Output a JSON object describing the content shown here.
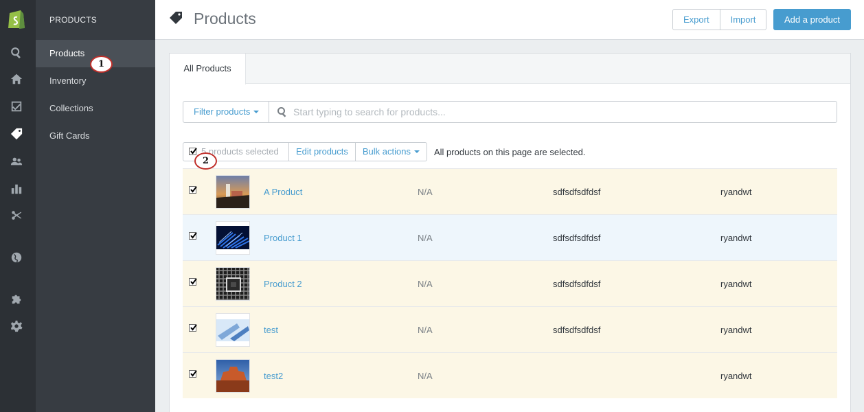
{
  "subnav": {
    "heading": "PRODUCTS",
    "items": [
      {
        "label": "Products"
      },
      {
        "label": "Inventory"
      },
      {
        "label": "Collections"
      },
      {
        "label": "Gift Cards"
      }
    ]
  },
  "rail": {
    "icons": [
      "shopify-logo-icon",
      "search-icon",
      "home-icon",
      "orders-icon",
      "tag-icon",
      "customers-icon",
      "reports-icon",
      "discounts-icon",
      "globe-icon",
      "apps-icon",
      "settings-icon"
    ]
  },
  "header": {
    "title": "Products",
    "export_label": "Export",
    "import_label": "Import",
    "add_label": "Add a product"
  },
  "tabs": [
    {
      "label": "All Products"
    }
  ],
  "filter": {
    "button_label": "Filter products",
    "search_placeholder": "Start typing to search for products..."
  },
  "bulk": {
    "selected_label": "5 products selected",
    "edit_label": "Edit products",
    "actions_label": "Bulk actions",
    "note": "All products on this page are selected."
  },
  "products": [
    {
      "name": "A Product",
      "inventory": "N/A",
      "type": "sdfsdfsdfdsf",
      "vendor": "ryandwt"
    },
    {
      "name": "Product 1",
      "inventory": "N/A",
      "type": "sdfsdfsdfdsf",
      "vendor": "ryandwt"
    },
    {
      "name": "Product 2",
      "inventory": "N/A",
      "type": "sdfsdfsdfdsf",
      "vendor": "ryandwt"
    },
    {
      "name": "test",
      "inventory": "N/A",
      "type": "sdfsdfsdfdsf",
      "vendor": "ryandwt"
    },
    {
      "name": "test2",
      "inventory": "N/A",
      "type": "",
      "vendor": "ryandwt"
    }
  ],
  "annotations": [
    "1",
    "2"
  ],
  "colors": {
    "accent": "#479ccf",
    "rail": "#2c3035",
    "subnav": "#373c42",
    "selected_row": "#fcf7e6",
    "hover_row": "#eef6fc",
    "annotation_ring": "#c0302b"
  }
}
